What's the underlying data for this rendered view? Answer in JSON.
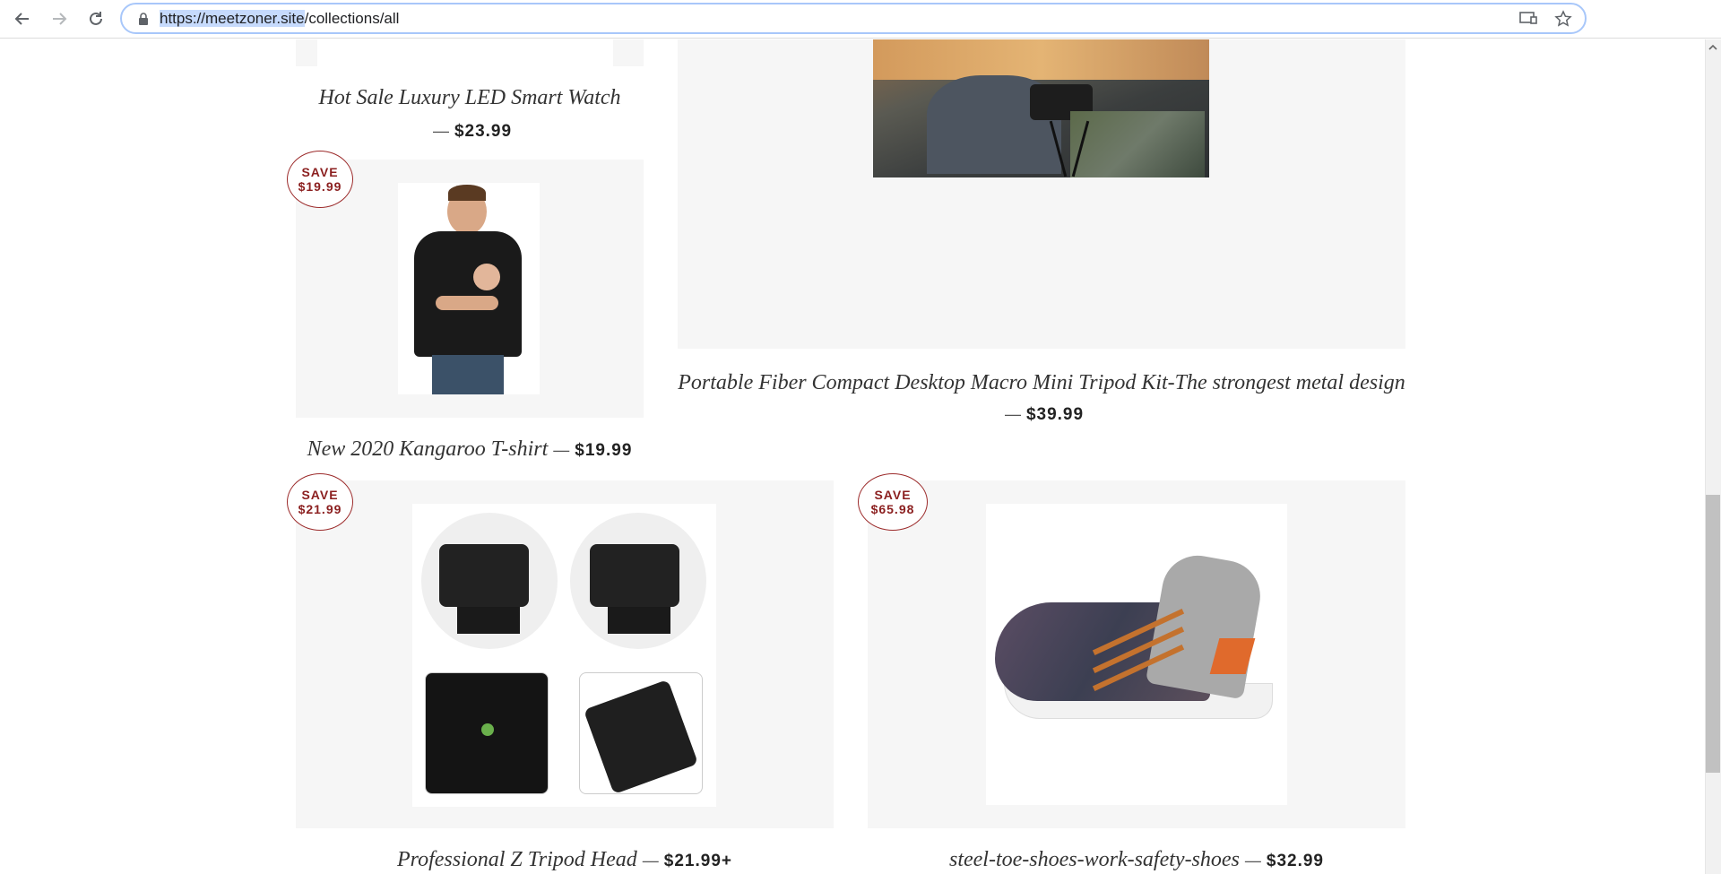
{
  "browser": {
    "url_highlight": "https://meetzoner.site",
    "url_rest": "/collections/all"
  },
  "products": {
    "watch": {
      "title": "Hot Sale Luxury LED Smart Watch",
      "dash": "—",
      "price": "$23.99"
    },
    "tshirt": {
      "title": "New 2020 Kangaroo T-shirt",
      "dash": "—",
      "price": "$19.99",
      "badge_line1": "SAVE",
      "badge_line2": "$19.99"
    },
    "tripod_kit": {
      "title": "Portable Fiber Compact Desktop Macro Mini Tripod Kit-The strongest metal design",
      "dash": "—",
      "price": "$39.99"
    },
    "z_tripod": {
      "title": "Professional Z Tripod Head",
      "dash": "—",
      "price": "$21.99+",
      "badge_line1": "SAVE",
      "badge_line2": "$21.99"
    },
    "shoes": {
      "title": "steel-toe-shoes-work-safety-shoes",
      "dash": "—",
      "price": "$32.99",
      "badge_line1": "SAVE",
      "badge_line2": "$65.98"
    }
  },
  "colors": {
    "badge": "#8b1f1f",
    "card_bg": "#f6f6f6",
    "accent": "#1a73e8"
  }
}
